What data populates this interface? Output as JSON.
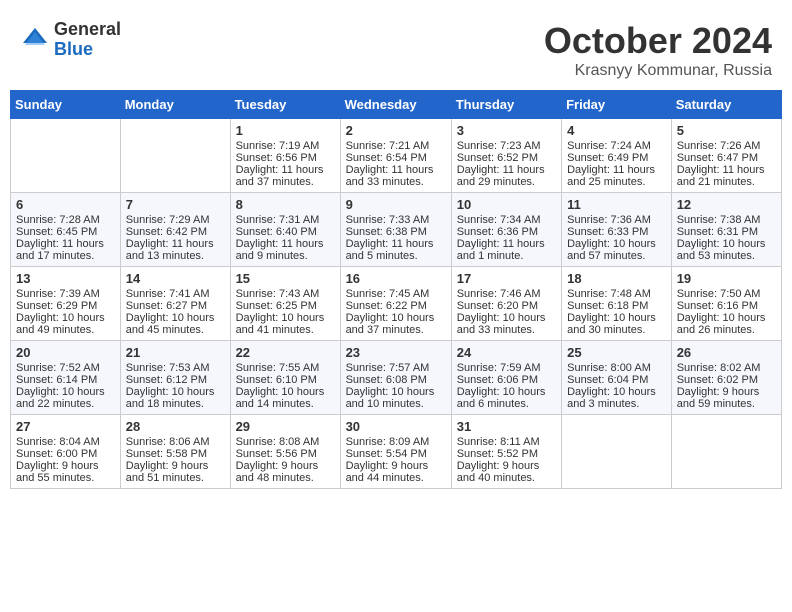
{
  "header": {
    "logo_general": "General",
    "logo_blue": "Blue",
    "month_title": "October 2024",
    "location": "Krasnyy Kommunar, Russia"
  },
  "days_of_week": [
    "Sunday",
    "Monday",
    "Tuesday",
    "Wednesday",
    "Thursday",
    "Friday",
    "Saturday"
  ],
  "weeks": [
    [
      {
        "day": "",
        "content": ""
      },
      {
        "day": "",
        "content": ""
      },
      {
        "day": "1",
        "content": "Sunrise: 7:19 AM\nSunset: 6:56 PM\nDaylight: 11 hours and 37 minutes."
      },
      {
        "day": "2",
        "content": "Sunrise: 7:21 AM\nSunset: 6:54 PM\nDaylight: 11 hours and 33 minutes."
      },
      {
        "day": "3",
        "content": "Sunrise: 7:23 AM\nSunset: 6:52 PM\nDaylight: 11 hours and 29 minutes."
      },
      {
        "day": "4",
        "content": "Sunrise: 7:24 AM\nSunset: 6:49 PM\nDaylight: 11 hours and 25 minutes."
      },
      {
        "day": "5",
        "content": "Sunrise: 7:26 AM\nSunset: 6:47 PM\nDaylight: 11 hours and 21 minutes."
      }
    ],
    [
      {
        "day": "6",
        "content": "Sunrise: 7:28 AM\nSunset: 6:45 PM\nDaylight: 11 hours and 17 minutes."
      },
      {
        "day": "7",
        "content": "Sunrise: 7:29 AM\nSunset: 6:42 PM\nDaylight: 11 hours and 13 minutes."
      },
      {
        "day": "8",
        "content": "Sunrise: 7:31 AM\nSunset: 6:40 PM\nDaylight: 11 hours and 9 minutes."
      },
      {
        "day": "9",
        "content": "Sunrise: 7:33 AM\nSunset: 6:38 PM\nDaylight: 11 hours and 5 minutes."
      },
      {
        "day": "10",
        "content": "Sunrise: 7:34 AM\nSunset: 6:36 PM\nDaylight: 11 hours and 1 minute."
      },
      {
        "day": "11",
        "content": "Sunrise: 7:36 AM\nSunset: 6:33 PM\nDaylight: 10 hours and 57 minutes."
      },
      {
        "day": "12",
        "content": "Sunrise: 7:38 AM\nSunset: 6:31 PM\nDaylight: 10 hours and 53 minutes."
      }
    ],
    [
      {
        "day": "13",
        "content": "Sunrise: 7:39 AM\nSunset: 6:29 PM\nDaylight: 10 hours and 49 minutes."
      },
      {
        "day": "14",
        "content": "Sunrise: 7:41 AM\nSunset: 6:27 PM\nDaylight: 10 hours and 45 minutes."
      },
      {
        "day": "15",
        "content": "Sunrise: 7:43 AM\nSunset: 6:25 PM\nDaylight: 10 hours and 41 minutes."
      },
      {
        "day": "16",
        "content": "Sunrise: 7:45 AM\nSunset: 6:22 PM\nDaylight: 10 hours and 37 minutes."
      },
      {
        "day": "17",
        "content": "Sunrise: 7:46 AM\nSunset: 6:20 PM\nDaylight: 10 hours and 33 minutes."
      },
      {
        "day": "18",
        "content": "Sunrise: 7:48 AM\nSunset: 6:18 PM\nDaylight: 10 hours and 30 minutes."
      },
      {
        "day": "19",
        "content": "Sunrise: 7:50 AM\nSunset: 6:16 PM\nDaylight: 10 hours and 26 minutes."
      }
    ],
    [
      {
        "day": "20",
        "content": "Sunrise: 7:52 AM\nSunset: 6:14 PM\nDaylight: 10 hours and 22 minutes."
      },
      {
        "day": "21",
        "content": "Sunrise: 7:53 AM\nSunset: 6:12 PM\nDaylight: 10 hours and 18 minutes."
      },
      {
        "day": "22",
        "content": "Sunrise: 7:55 AM\nSunset: 6:10 PM\nDaylight: 10 hours and 14 minutes."
      },
      {
        "day": "23",
        "content": "Sunrise: 7:57 AM\nSunset: 6:08 PM\nDaylight: 10 hours and 10 minutes."
      },
      {
        "day": "24",
        "content": "Sunrise: 7:59 AM\nSunset: 6:06 PM\nDaylight: 10 hours and 6 minutes."
      },
      {
        "day": "25",
        "content": "Sunrise: 8:00 AM\nSunset: 6:04 PM\nDaylight: 10 hours and 3 minutes."
      },
      {
        "day": "26",
        "content": "Sunrise: 8:02 AM\nSunset: 6:02 PM\nDaylight: 9 hours and 59 minutes."
      }
    ],
    [
      {
        "day": "27",
        "content": "Sunrise: 8:04 AM\nSunset: 6:00 PM\nDaylight: 9 hours and 55 minutes."
      },
      {
        "day": "28",
        "content": "Sunrise: 8:06 AM\nSunset: 5:58 PM\nDaylight: 9 hours and 51 minutes."
      },
      {
        "day": "29",
        "content": "Sunrise: 8:08 AM\nSunset: 5:56 PM\nDaylight: 9 hours and 48 minutes."
      },
      {
        "day": "30",
        "content": "Sunrise: 8:09 AM\nSunset: 5:54 PM\nDaylight: 9 hours and 44 minutes."
      },
      {
        "day": "31",
        "content": "Sunrise: 8:11 AM\nSunset: 5:52 PM\nDaylight: 9 hours and 40 minutes."
      },
      {
        "day": "",
        "content": ""
      },
      {
        "day": "",
        "content": ""
      }
    ]
  ]
}
